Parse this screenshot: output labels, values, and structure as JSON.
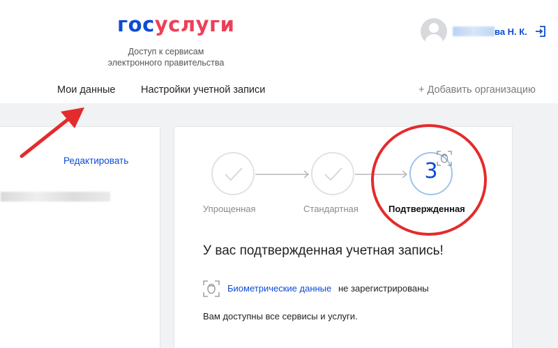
{
  "header": {
    "logo_part1": "гос",
    "logo_part2": "услуги",
    "tagline_line1": "Доступ к сервисам",
    "tagline_line2": "электронного правительства"
  },
  "user": {
    "name_suffix": "ва Н. К.",
    "avatar_icon": "user-avatar-icon",
    "logout_icon": "logout-icon"
  },
  "nav": {
    "tabs": [
      {
        "label": "Мои данные",
        "active": true
      },
      {
        "label": "Настройки учетной записи",
        "active": false
      }
    ],
    "add_org": "+ Добавить организацию"
  },
  "left_panel": {
    "edit_label": "Редактировать"
  },
  "status": {
    "steps": [
      {
        "label": "Упрощенная",
        "state": "done"
      },
      {
        "label": "Стандартная",
        "state": "done"
      },
      {
        "label": "Подтвержденная",
        "state": "current",
        "number": "3"
      }
    ],
    "title": "У вас подтвержденная учетная запись!",
    "biometric_link": "Биометрические данные",
    "biometric_rest": "не зарегистрированы",
    "services_text": "Вам доступны все сервисы и услуги."
  },
  "colors": {
    "brand_blue": "#0d4cd3",
    "brand_red": "#ee3f58",
    "annotation_red": "#e42b2b"
  }
}
